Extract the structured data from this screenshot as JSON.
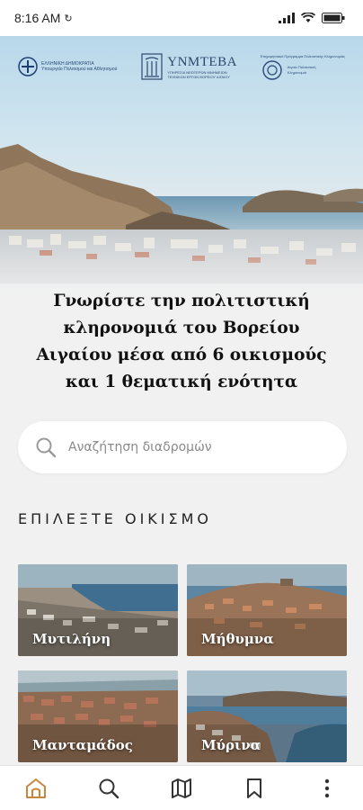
{
  "status": {
    "time": "8:16 AM"
  },
  "logos": {
    "left_line1": "ΕΛΛΗΝΙΚΗ ΔΗΜΟΚΡΑΤΙΑ",
    "left_line2": "Υπουργείο Πολιτισμού και Αθλητισμού",
    "center_title": "ΥΝΜΤΕΒΑ",
    "center_sub1": "ΥΠΗΡΕΣΙΑ ΝΕΩΤΕΡΩΝ ΜΝΗΜΕΙΩΝ",
    "center_sub2": "ΤΕΧΝΙΚΩΝ ΕΡΓΩΝ ΒΟΡΕΙΟΥ ΑΙΓΑΙΟΥ",
    "right_line1": "Επιχειρησιακό Πρόγραμμα Πολιτιστικής Κληρονομιάς",
    "right_line2": "Αιγαίο Πολιτιστική Κληρονομιά"
  },
  "headline": "Γνωρίστε την πολιτιστική κληρονομιά του Βορείου Αιγαίου μέσα από 6 οικισμούς και 1 θεματική ενότητα",
  "search": {
    "placeholder": "Αναζήτηση διαδρομών"
  },
  "section_title": "ΕΠΙΛΕΞΤΕ ΟΙΚΙΣΜΟ",
  "settlements": [
    {
      "name": "Μυτιλήνη"
    },
    {
      "name": "Μήθυμνα"
    },
    {
      "name": "Μανταμάδος"
    },
    {
      "name": "Μύρινα"
    }
  ],
  "nav": {
    "items": [
      "home-icon",
      "search-icon",
      "map-icon",
      "bookmark-icon",
      "more-icon"
    ],
    "active": "home-icon",
    "active_color": "#c8873a",
    "inactive_color": "#333333"
  }
}
